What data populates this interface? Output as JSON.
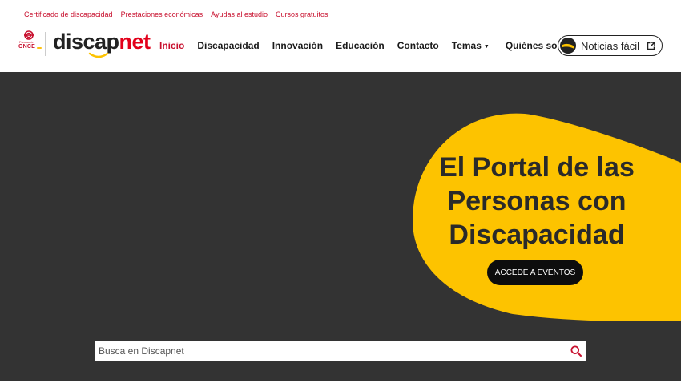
{
  "top_links": [
    {
      "label": "Certificado de discapacidad"
    },
    {
      "label": "Prestaciones económicas"
    },
    {
      "label": "Ayudas al estudio"
    },
    {
      "label": "Cursos gratuitos"
    }
  ],
  "logo": {
    "fundacion": "Fundación",
    "once": "ONCE",
    "brand_part1": "discap",
    "brand_part2": "net"
  },
  "nav": [
    {
      "label": "Inicio",
      "active": true
    },
    {
      "label": "Discapacidad"
    },
    {
      "label": "Innovación"
    },
    {
      "label": "Educación"
    },
    {
      "label": "Contacto"
    },
    {
      "label": "Temas",
      "dropdown": true
    },
    {
      "label": "Quiénes somos"
    }
  ],
  "noticias_button": {
    "label": "Noticias fácil"
  },
  "hero": {
    "title_line1": "El Portal de las",
    "title_line2": "Personas con",
    "title_line3": "Discapacidad",
    "cta_label": "ACCEDE A EVENTOS"
  },
  "search": {
    "placeholder": "Busca en Discapnet",
    "value": ""
  },
  "colors": {
    "brand_red": "#c8102e",
    "hero_bg": "#333333",
    "accent_yellow": "#fdc300",
    "text_dark": "#1a1a1a"
  }
}
